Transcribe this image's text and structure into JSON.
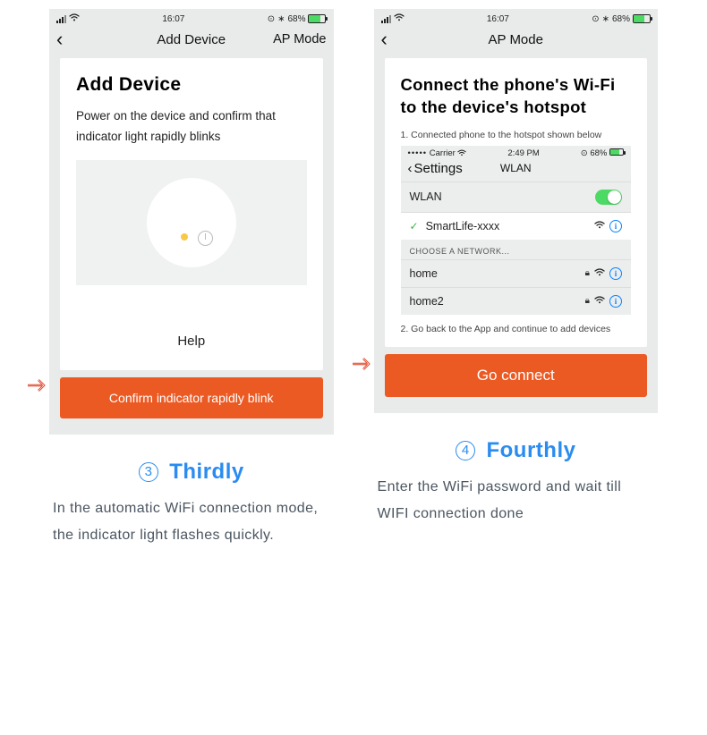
{
  "left": {
    "status": {
      "time": "16:07",
      "battery_pct": "68%"
    },
    "nav": {
      "title": "Add Device",
      "right": "AP Mode"
    },
    "card": {
      "title": "Add Device",
      "desc": "Power on the device and confirm that indicator light rapidly blinks",
      "help": "Help"
    },
    "button": "Confirm indicator rapidly blink",
    "caption_num": "3",
    "caption_word": "Thirdly",
    "blurb": "In the automatic WiFi connection mode, the indicator light flashes quickly."
  },
  "right": {
    "status": {
      "time": "16:07",
      "battery_pct": "68%"
    },
    "nav": {
      "title": "AP Mode"
    },
    "card": {
      "title": "Connect the phone's Wi-Fi to the device's hotspot",
      "step1": "1. Connected phone to the hotspot shown below",
      "wifi_status": {
        "carrier": "Carrier",
        "time": "2:49 PM",
        "battery_pct": "68%"
      },
      "wifi_back": "Settings",
      "wifi_title": "WLAN",
      "wlan_label": "WLAN",
      "selected": "SmartLife-xxxx",
      "choose_label": "CHOOSE A NETWORK...",
      "networks": [
        "home",
        "home2"
      ],
      "step2": "2. Go back to the App and continue to add devices"
    },
    "button": "Go connect",
    "caption_num": "4",
    "caption_word": "Fourthly",
    "blurb": "Enter the WiFi password and wait till WIFI connection done"
  }
}
